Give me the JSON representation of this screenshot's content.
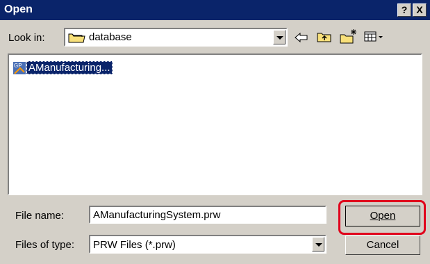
{
  "window": {
    "title": "Open"
  },
  "lookin": {
    "label": "Look in:",
    "value": "database"
  },
  "files": [
    {
      "name": "AManufacturing..."
    }
  ],
  "filename": {
    "label": "File name:",
    "value": "AManufacturingSystem.prw"
  },
  "filetype": {
    "label": "Files of type:",
    "value": "PRW Files (*.prw)"
  },
  "buttons": {
    "open": "Open",
    "cancel": "Cancel",
    "help": "?",
    "close": "X"
  },
  "icons": [
    "folder-icon",
    "back-arrow-icon",
    "up-folder-icon",
    "new-folder-icon",
    "view-menu-icon",
    "gp-file-icon"
  ],
  "colors": {
    "title_bar": "#0a246a",
    "highlight": "#e0001b"
  }
}
